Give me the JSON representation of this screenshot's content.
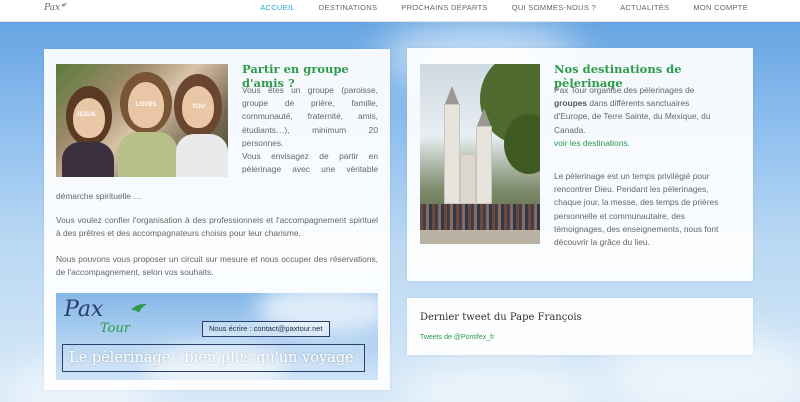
{
  "header": {
    "logo_text": "Pax",
    "nav": [
      {
        "label": "ACCUEIL",
        "active": true
      },
      {
        "label": "DESTINATIONS",
        "active": false
      },
      {
        "label": "PROCHAINS DÉPARTS",
        "active": false
      },
      {
        "label": "QUI SOMMES-NOUS ?",
        "active": false
      },
      {
        "label": "ACTUALITÉS",
        "active": false
      },
      {
        "label": "MON COMPTE",
        "active": false
      }
    ]
  },
  "left": {
    "title": "Partir en groupe d'amis ?",
    "intro_lines": [
      "Vous êtes un groupe (paroisse,",
      "groupe de prière, famille,",
      "communauté, fraternité, amis,",
      "étudiants…), minimum 20",
      "personnes.",
      "Vous envisagez de partir en",
      "pèlerinage avec une véritable"
    ],
    "intro_tail": "démarche spirituelle …",
    "para2": "Vous voulez confier l'organisation à des professionnels et l'accompagnement spirituel à des prêtres et des accompagnateurs choisis pour leur charisme.",
    "para3": "Nous pouvons vous proposer un circuit sur mesure et nous occuper des réservations, de l'accompagnement, selon vos souhaits.",
    "photo_signs": [
      "JESUS",
      "LOVES",
      "YOU"
    ],
    "banner": {
      "logo_line1": "Pax",
      "logo_line2": "Tour",
      "email": "Nous écrire : contact@paxtour.net",
      "tagline": "Le pèlerinage : bien plus qu'un voyage"
    }
  },
  "right": {
    "title": "Nos destinations de pèlerinage",
    "p1_a": "Pax Tour organise des pèlerinages de",
    "p1_b_bold": "groupes",
    "p1_b_rest": " dans différents sanctuaires",
    "p1_c": "d'Europe, de Terre Sainte, du Mexique, du",
    "p1_d": "Canada.",
    "link": "voir les destinations.",
    "p2_lines": [
      "Le pèlerinage est un temps privilégié pour",
      "rencontrer Dieu. Pendant les pèlerinages,",
      "chaque jour, la messe, des temps de prières",
      "personnelle et communautaire, des",
      "témoignages, des enseignements, nous font",
      "découvrir la grâce du lieu."
    ]
  },
  "tweet": {
    "title": "Dernier tweet du Pape François",
    "link": "Tweets de @Pontifex_fr"
  },
  "colors": {
    "accent_green": "#2e9b4a",
    "nav_active": "#2a9fd6"
  }
}
